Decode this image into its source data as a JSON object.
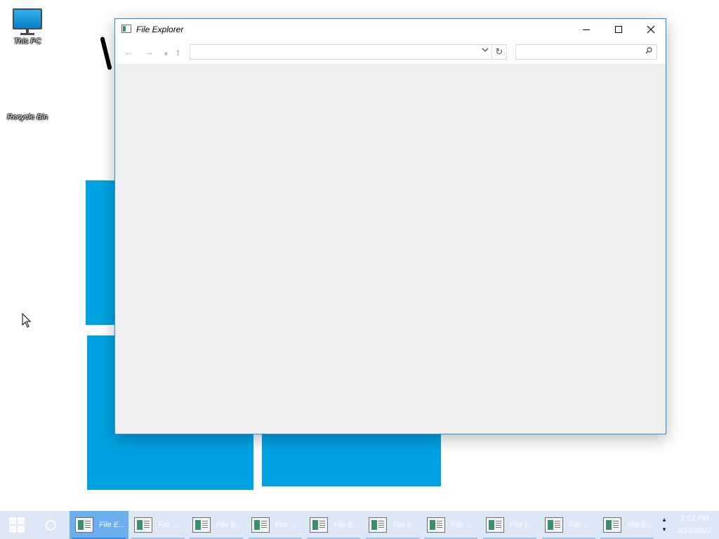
{
  "desktop": {
    "icons": [
      {
        "label": "This PC",
        "icon": "monitor-icon"
      },
      {
        "label": "Recycle Bin",
        "icon": "recycle-bin-icon"
      }
    ],
    "wallpaper_color": "#00a2e2"
  },
  "window": {
    "title": "File Explorer",
    "icon": "file-explorer-icon",
    "controls": {
      "minimize": "minimize-icon",
      "maximize": "maximize-icon",
      "close": "close-icon"
    },
    "address_value": "",
    "search_placeholder": "",
    "border_color": "#2b8fd9",
    "content_bg": "#efefef"
  },
  "taskbar": {
    "bg": "#dce8f5",
    "accent": "#6aaef0",
    "items": [
      {
        "label": "File E...",
        "active": true
      },
      {
        "label": "File ...",
        "active": false
      },
      {
        "label": "File E...",
        "active": false
      },
      {
        "label": "File ...",
        "active": false
      },
      {
        "label": "File E...",
        "active": false
      },
      {
        "label": "File E...",
        "active": false
      },
      {
        "label": "File ...",
        "active": false
      },
      {
        "label": "File E...",
        "active": false
      },
      {
        "label": "File ...",
        "active": false
      },
      {
        "label": "File E...",
        "active": false
      }
    ],
    "clock": {
      "time": "3:53 PM",
      "date": "3/16/2022"
    }
  }
}
